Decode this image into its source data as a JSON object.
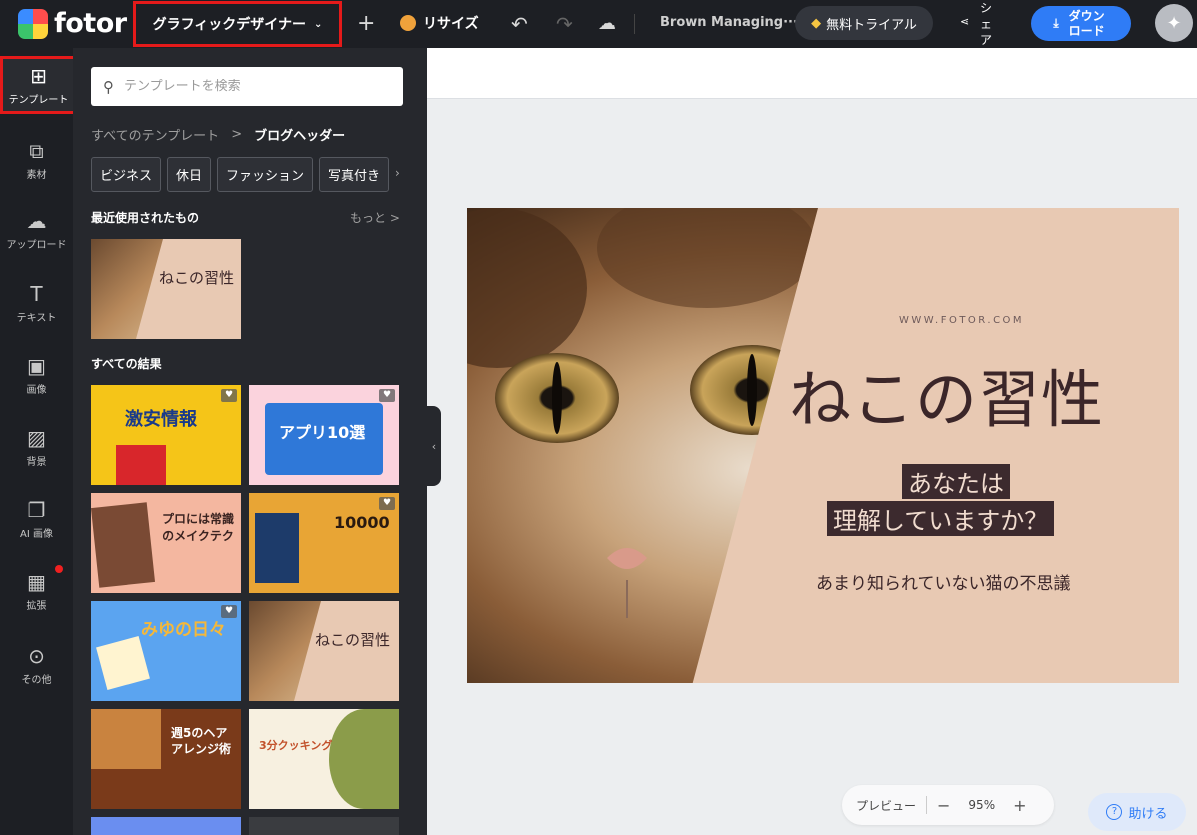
{
  "header": {
    "logo_text": "fotor",
    "designer_label": "グラフィックデザイナー",
    "resize_label": "リサイズ",
    "doc_title": "Brown Managing···",
    "trial_label": "無料トライアル",
    "share_label": "シェア",
    "download_label": "ダウンロード"
  },
  "rail": [
    {
      "label": "テンプレート",
      "icon": "template-icon"
    },
    {
      "label": "素材",
      "icon": "elements-icon"
    },
    {
      "label": "アップロード",
      "icon": "upload-icon"
    },
    {
      "label": "テキスト",
      "icon": "text-icon"
    },
    {
      "label": "画像",
      "icon": "image-icon"
    },
    {
      "label": "背景",
      "icon": "background-icon"
    },
    {
      "label": "AI 画像",
      "icon": "ai-image-icon"
    },
    {
      "label": "拡張",
      "icon": "extensions-icon"
    },
    {
      "label": "その他",
      "icon": "more-icon"
    }
  ],
  "panel": {
    "search_placeholder": "テンプレートを検索",
    "breadcrumb_root": "すべてのテンプレート",
    "breadcrumb_sep": ">",
    "breadcrumb_current": "ブログヘッダー",
    "chips": [
      "ビジネス",
      "休日",
      "ファッション",
      "写真付き"
    ],
    "recent_title": "最近使用されたもの",
    "more_label": "もっと >",
    "all_results_title": "すべての結果",
    "templates": [
      {
        "title": "ねこの習性"
      },
      {
        "title": "激安情報"
      },
      {
        "title": "アプリ10選"
      },
      {
        "title": "プロには常識のメイクテク"
      },
      {
        "title": "10000"
      },
      {
        "title": "みゆの日々"
      },
      {
        "title": "ねこの習性"
      },
      {
        "title": "週5のヘアアレンジ術"
      },
      {
        "title": "3分クッキング"
      }
    ]
  },
  "design": {
    "url": "WWW.FOTOR.COM",
    "title": "ねこの習性",
    "highlight1": "あなたは",
    "highlight2": "理解していますか？",
    "subtitle": "あまり知られていない猫の不思議"
  },
  "zoom": {
    "preview_label": "プレビュー",
    "value": "95%"
  },
  "help_label": "助ける",
  "colors": {
    "accent": "#2f7cf6",
    "highlight_border": "#e51a1a",
    "dark_bg": "#1d1f24",
    "panel_bg": "#26282d",
    "design_bg": "#e8c9b3"
  }
}
